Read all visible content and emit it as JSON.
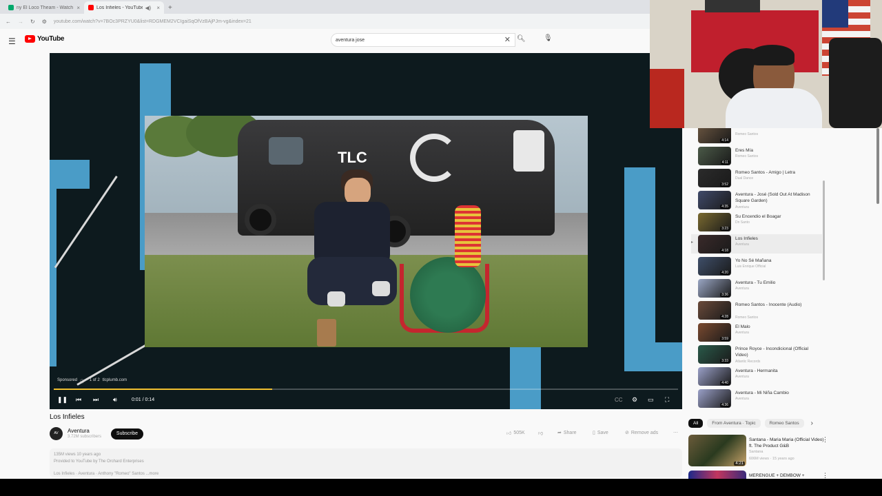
{
  "browser": {
    "tabs": [
      {
        "title": "ny El Loco Theam - Watch Li",
        "active": false,
        "color": "#00a86b"
      },
      {
        "title": "Los Infieles - YouTube",
        "active": true,
        "color": "#ff0000"
      }
    ],
    "url": "youtube.com/watch?v=7BOc3PRZYU0&list=RDGMEM2VCIgaiSqOfVzBAjPJm-vg&index=21"
  },
  "youtube": {
    "logo_text": "YouTube",
    "search_value": "aventura jose"
  },
  "player": {
    "ad_label": "Sponsored",
    "ad_count": "· 1 of 2",
    "ad_site": "tlcplumb.com",
    "time": "0:01 / 0:14",
    "progress": 0.35,
    "van_brand": "TLC"
  },
  "video": {
    "title": "Los Infieles",
    "channel": "Aventura",
    "subscribers": "3.72M subscribers",
    "subscribe_label": "Subscribe",
    "likes": "505K",
    "share_label": "Share",
    "save_label": "Save",
    "remove_ads_label": "Remove ads",
    "views": "135M views  10 years ago",
    "provided": "Provided to YouTube by The Orchard Enterprises",
    "desc_line": "Los Infieles · Aventura · Anthony \"Romeo\" Santos   ...more"
  },
  "playlist": [
    {
      "title": "",
      "channel": "Romeo Santos",
      "duration": "4:14"
    },
    {
      "title": "Eres Mía",
      "channel": "Romeo Santos",
      "duration": "4:11"
    },
    {
      "title": "Romeo Santos - Amigo | Letra",
      "channel": "Dual Dance",
      "duration": "3:52"
    },
    {
      "title": "Aventura - José (Sold Out At Madison Square Garden)",
      "channel": "Aventura",
      "duration": "4:35"
    },
    {
      "title": "Su Encendio el Boagar",
      "channel": "Dn Santo",
      "duration": "3:23"
    },
    {
      "title": "Los Infieles",
      "channel": "Aventura",
      "duration": "4:18",
      "current": true
    },
    {
      "title": "Yo No Sé Mañana",
      "channel": "Luis Enrique Official",
      "duration": "4:20"
    },
    {
      "title": "Aventura - Tu Emilio",
      "channel": "Aventura",
      "duration": "3:36"
    },
    {
      "title": "Romeo Santos - Inocente (Audio)",
      "channel": "Romeo Santos",
      "duration": "4:28"
    },
    {
      "title": "El Malo",
      "channel": "Aventura",
      "duration": "3:59"
    },
    {
      "title": "Prince Royce - Incondicional (Official Video)",
      "channel": "Atlantic Records",
      "duration": "3:33"
    },
    {
      "title": "Aventura - Hermanita",
      "channel": "Aventura",
      "duration": "4:40"
    },
    {
      "title": "Aventura - Mi Niña Cambio",
      "channel": "Aventura",
      "duration": "4:36"
    }
  ],
  "chips": [
    "All",
    "From Aventura · Topic",
    "Romeo Santos"
  ],
  "recommendations": [
    {
      "title": "Santana - Maria Maria (Official Video) ft. The Product G&B",
      "channel": "Santana",
      "meta": "606M views · 15 years ago",
      "duration": "4:21"
    },
    {
      "title": "MERENGUE + DEMBOW +",
      "channel": "",
      "meta": "",
      "duration": ""
    }
  ]
}
